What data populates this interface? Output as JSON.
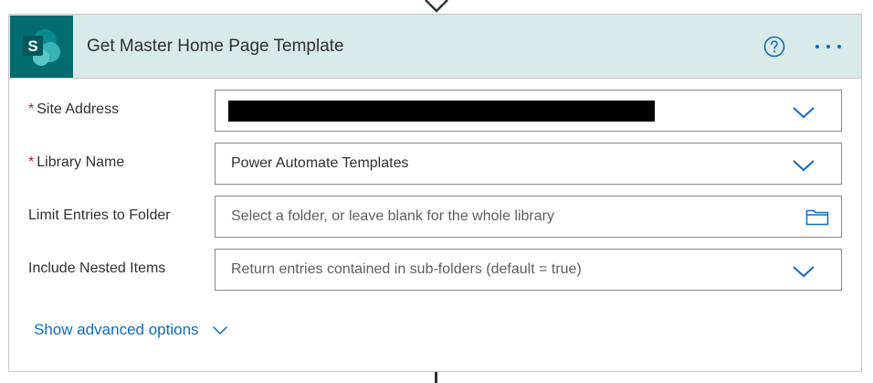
{
  "action": {
    "title": "Get Master Home Page Template",
    "app_icon": "sharepoint-icon",
    "app_icon_letter": "S",
    "help_icon": "help-icon",
    "more_icon": "more-options-icon"
  },
  "fields": [
    {
      "label": "Site Address",
      "required": true,
      "required_mark": "*",
      "value": "",
      "redacted": true,
      "control": "dropdown"
    },
    {
      "label": "Library Name",
      "required": true,
      "required_mark": "*",
      "value": "Power Automate Templates",
      "control": "dropdown"
    },
    {
      "label": "Limit Entries to Folder",
      "required": false,
      "placeholder": "Select a folder, or leave blank for the whole library",
      "control": "folder-picker"
    },
    {
      "label": "Include Nested Items",
      "required": false,
      "placeholder": "Return entries contained in sub-folders (default = true)",
      "control": "dropdown"
    }
  ],
  "advanced": {
    "label": "Show advanced options"
  },
  "colors": {
    "header_bg": "#d8eaea",
    "sharepoint_bg": "#036c70",
    "accent": "#0f6cbd",
    "required": "#a4262c"
  }
}
